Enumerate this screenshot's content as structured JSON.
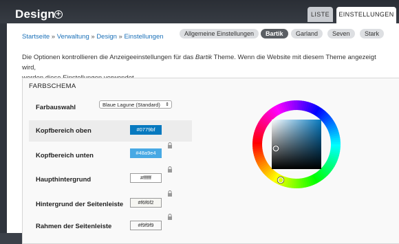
{
  "header": {
    "title": "Design",
    "tabs": [
      {
        "label": "LISTE"
      },
      {
        "label": "EINSTELLUNGEN"
      }
    ]
  },
  "breadcrumb": [
    "Startseite",
    "Verwaltung",
    "Design",
    "Einstellungen"
  ],
  "theme_pills": [
    {
      "label": "Allgemeine Einstellungen"
    },
    {
      "label": "Bartik"
    },
    {
      "label": "Garland"
    },
    {
      "label": "Seven"
    },
    {
      "label": "Stark"
    }
  ],
  "description": {
    "before": "Die Optionen kontrollieren die Anzeigeeinstellungen für das ",
    "theme": "Bartik",
    "after": " Theme. Wenn die Website mit diesem Theme angezeigt wird,",
    "line2": "werden diese Einstellungen verwendet."
  },
  "colorscheme": {
    "legend": "FARBSCHEMA",
    "select_label": "Farbauswahl",
    "select_value": "Blaue Lagune (Standard)",
    "fields": [
      {
        "label": "Kopfbereich oben",
        "value": "#0779bf",
        "color": "#0779bf",
        "text_color": "#ffffff"
      },
      {
        "label": "Kopfbereich unten",
        "value": "#48a9e4",
        "color": "#48a9e4",
        "text_color": "#ffffff"
      },
      {
        "label": "Haupthintergrund",
        "value": "#ffffff",
        "color": "#ffffff",
        "text_color": "#222222"
      },
      {
        "label": "Hintergrund der Seitenleiste",
        "value": "#f6f6f2",
        "color": "#f6f6f2",
        "text_color": "#222222"
      },
      {
        "label": "Rahmen der Seitenleiste",
        "value": "#f9f9f9",
        "color": "#f9f9f9",
        "text_color": "#222222"
      }
    ]
  }
}
